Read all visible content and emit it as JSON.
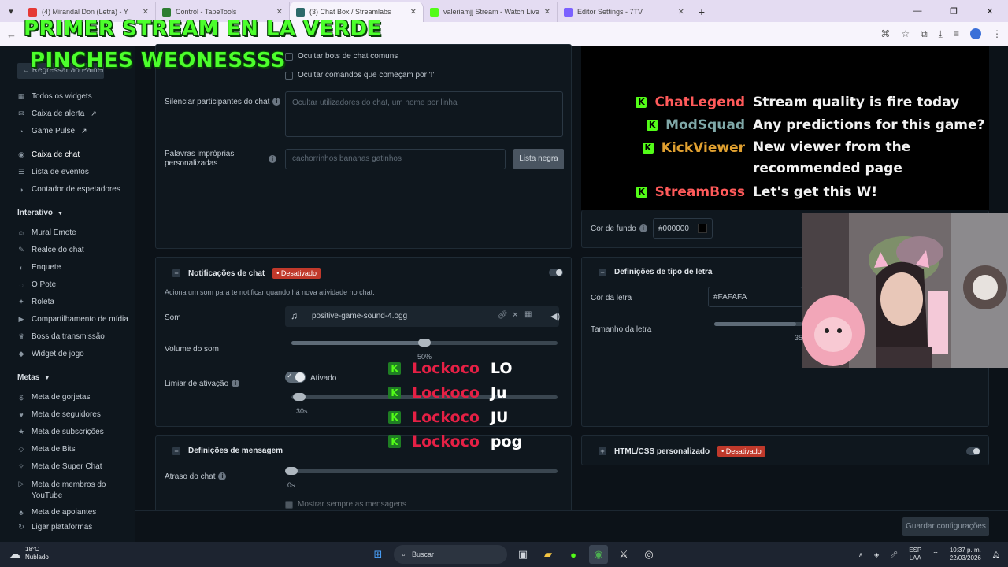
{
  "browser": {
    "tabs": [
      {
        "title": "(4) Mirandal Don (Letra) - Y",
        "color": "#e53935",
        "active": false
      },
      {
        "title": "Control - TapeTools",
        "color": "#2e7d32",
        "active": false
      },
      {
        "title": "(3) Chat Box / Streamlabs",
        "color": "#2d6a6a",
        "active": true
      },
      {
        "title": "valeriamjj Stream - Watch Live",
        "color": "#53fc18",
        "active": false
      },
      {
        "title": "Editor Settings - 7TV",
        "color": "#7b61ff",
        "active": false
      }
    ],
    "new_tab": "+",
    "win_min": "—",
    "win_max": "❐",
    "win_close": "✕"
  },
  "overlay": {
    "line1": "PRIMER STREAM EN LA VERDE",
    "line2": "PINCHES WEONESSSS"
  },
  "sidebar": {
    "back_label": "Regressar ao Painel",
    "items_top": [
      {
        "label": "Todos os widgets",
        "icon": "grid-icon"
      },
      {
        "label": "Caixa de alerta",
        "icon": "alert-icon",
        "ext": true
      },
      {
        "label": "Game Pulse",
        "icon": "pulse-icon",
        "ext": true
      },
      {
        "label": "Caixa de chat",
        "icon": "chat-icon",
        "active": true
      },
      {
        "label": "Lista de eventos",
        "icon": "list-icon"
      },
      {
        "label": "Contador de espetadores",
        "icon": "viewers-icon"
      }
    ],
    "section_interactive": "Interativo",
    "items_interactive": [
      {
        "label": "Mural Emote",
        "icon": "emote-icon"
      },
      {
        "label": "Realce do chat",
        "icon": "highlight-icon"
      },
      {
        "label": "Enquete",
        "icon": "poll-icon"
      },
      {
        "label": "O Pote",
        "icon": "pot-icon"
      },
      {
        "label": "Roleta",
        "icon": "wheel-icon"
      },
      {
        "label": "Compartilhamento de mídia",
        "icon": "media-icon"
      },
      {
        "label": "Boss da transmissão",
        "icon": "boss-icon"
      },
      {
        "label": "Widget de jogo",
        "icon": "game-icon"
      }
    ],
    "section_goals": "Metas",
    "items_goals": [
      {
        "label": "Meta de gorjetas",
        "icon": "tip-icon"
      },
      {
        "label": "Meta de seguidores",
        "icon": "follower-icon"
      },
      {
        "label": "Meta de subscrições",
        "icon": "sub-icon"
      },
      {
        "label": "Meta de Bits",
        "icon": "bits-icon"
      },
      {
        "label": "Meta de Super Chat",
        "icon": "superchat-icon"
      },
      {
        "label": "Meta de membros do",
        "label2": "YouTube",
        "icon": "youtube-icon"
      },
      {
        "label": "Meta de apoiantes",
        "icon": "supporter-icon"
      }
    ],
    "connect_label": "Ligar plataformas"
  },
  "settings": {
    "hide_bots": "Ocultar bots de chat comuns",
    "hide_commands": "Ocultar comandos que começam por '!'",
    "mute_label": "Silenciar participantes do chat",
    "mute_placeholder": "Ocultar utilizadores do chat, um nome por linha",
    "badwords_label1": "Palavras impróprias",
    "badwords_label2": "personalizadas",
    "badwords_placeholder": "cachorrinhos bananas gatinhos",
    "blacklist_button": "Lista negra",
    "notif_title": "Notificações de chat",
    "notif_badge": "Desativado",
    "notif_desc": "Aciona um som para te notificar quando há nova atividade no chat.",
    "sound_label": "Som",
    "sound_file": "positive-game-sound-4.ogg",
    "volume_label": "Volume do som",
    "volume_value": "50%",
    "volume_fraction": 0.5,
    "threshold_label": "Limiar de ativação",
    "activated_label": "Ativado",
    "threshold_value": "30s",
    "message_title": "Definições de mensagem",
    "delay_label": "Atraso do chat",
    "delay_value": "0s",
    "always_show": "Mostrar sempre as mensagens",
    "bg_color_label": "Cor de fundo",
    "bg_color_value": "#000000",
    "font_title": "Definições de tipo de letra",
    "font_color_label": "Cor da letra",
    "font_color_value": "#FAFAFA",
    "font_size_label": "Tamanho da letra",
    "font_size_value": "35",
    "html_title": "HTML/CSS personalizado",
    "html_badge": "Desativado",
    "save_button": "Guardar configurações"
  },
  "preview_chat": [
    {
      "user": "ChatLegend",
      "color": "#ff5a5a",
      "text": "Stream quality is fire today"
    },
    {
      "user": "ModSquad",
      "color": "#7fa8a8",
      "text": "Any predictions for this game?"
    },
    {
      "user": "KickViewer",
      "color": "#e0a030",
      "text": "New viewer from the recommended page"
    },
    {
      "user": "StreamBoss",
      "color": "#ff5a5a",
      "text": "Let's get this W!"
    }
  ],
  "overlay_chat": [
    {
      "user": "Lockoco",
      "text": "LO"
    },
    {
      "user": "Lockoco",
      "text": "Ju"
    },
    {
      "user": "Lockoco",
      "text": "JU"
    },
    {
      "user": "Lockoco",
      "text": "pog"
    }
  ],
  "taskbar": {
    "temp": "18°C",
    "weather": "Nublado",
    "search": "Buscar",
    "lang1": "ESP",
    "lang2": "LAA",
    "time": "10:37 p. m.",
    "date": "22/03/2026"
  },
  "colors": {
    "kick_green": "#53fc18",
    "badge_red": "#c0392b",
    "overlay_green": "#4cff2c"
  }
}
